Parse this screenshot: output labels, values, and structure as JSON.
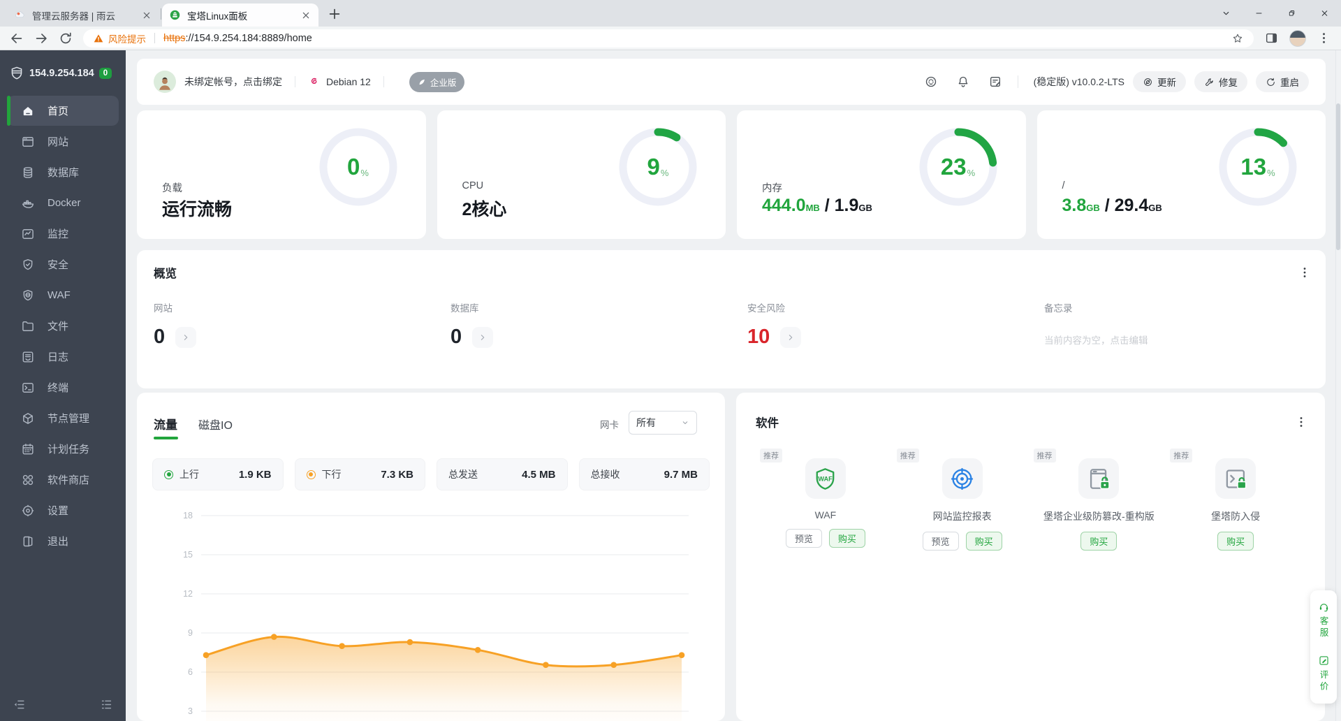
{
  "browser": {
    "tabs": [
      {
        "title": "管理云服务器 | 雨云"
      },
      {
        "title": "宝塔Linux面板"
      }
    ],
    "address": {
      "warning": "风险提示",
      "scheme": "https",
      "rest": "://154.9.254.184:8889/home"
    }
  },
  "sidebar": {
    "server_ip": "154.9.254.184",
    "badge": "0",
    "items": [
      {
        "label": "首页",
        "icon": "home",
        "active": true
      },
      {
        "label": "网站",
        "icon": "site"
      },
      {
        "label": "数据库",
        "icon": "database"
      },
      {
        "label": "Docker",
        "icon": "docker"
      },
      {
        "label": "监控",
        "icon": "monitor"
      },
      {
        "label": "安全",
        "icon": "safety"
      },
      {
        "label": "WAF",
        "icon": "waf"
      },
      {
        "label": "文件",
        "icon": "file"
      },
      {
        "label": "日志",
        "icon": "log"
      },
      {
        "label": "终端",
        "icon": "terminal"
      },
      {
        "label": "节点管理",
        "icon": "node"
      },
      {
        "label": "计划任务",
        "icon": "cron"
      },
      {
        "label": "软件商店",
        "icon": "store"
      },
      {
        "label": "设置",
        "icon": "setting"
      },
      {
        "label": "退出",
        "icon": "exit"
      }
    ]
  },
  "header": {
    "account": "未绑定帐号，点击绑定",
    "os": "Debian 12",
    "edition": "企业版",
    "version": "(稳定版) v10.0.2-LTS",
    "actions": [
      {
        "label": "更新",
        "icon": "update"
      },
      {
        "label": "修复",
        "icon": "wrench"
      },
      {
        "label": "重启",
        "icon": "restart"
      }
    ]
  },
  "stat_cards": [
    {
      "label": "负载",
      "value": "运行流畅",
      "percent": 0
    },
    {
      "label": "CPU",
      "value": "2核心",
      "percent": 9
    },
    {
      "label": "内存",
      "used": "444.0",
      "used_unit": "MB",
      "total": "1.9",
      "total_unit": "GB",
      "percent": 23
    },
    {
      "label": "/",
      "used": "3.8",
      "used_unit": "GB",
      "total": "29.4",
      "total_unit": "GB",
      "percent": 13
    }
  ],
  "overview": {
    "title": "概览",
    "items": [
      {
        "label": "网站",
        "value": "0",
        "color": "#1f242b"
      },
      {
        "label": "数据库",
        "value": "0",
        "color": "#1f242b"
      },
      {
        "label": "安全风险",
        "value": "10",
        "color": "#d9252b"
      },
      {
        "label": "备忘录",
        "placeholder": "当前内容为空，点击编辑"
      }
    ]
  },
  "traffic": {
    "tabs": [
      "流量",
      "磁盘IO"
    ],
    "active_tab": "流量",
    "nic_label": "网卡",
    "nic_value": "所有",
    "stats": [
      {
        "dot": "#21a53d",
        "label": "上行",
        "value": "1.9 KB"
      },
      {
        "dot": "#f7a125",
        "label": "下行",
        "value": "7.3 KB"
      },
      {
        "label": "总发送",
        "value": "4.5 MB"
      },
      {
        "label": "总接收",
        "value": "9.7 MB"
      }
    ],
    "chart_data": {
      "type": "area",
      "series": [
        {
          "name": "下行",
          "values": [
            7.3,
            8.7,
            8.0,
            8.3,
            7.7,
            6.55,
            6.55,
            7.3
          ]
        }
      ],
      "unit": "KB",
      "y_ticks": [
        18,
        15,
        12,
        9,
        6,
        3
      ],
      "ylim": [
        3,
        18
      ],
      "grid": true,
      "legend": false,
      "line_color": "#f7a125"
    }
  },
  "software": {
    "title": "软件",
    "items": [
      {
        "tag": "推荐",
        "icon": "wafapp",
        "name": "WAF",
        "buttons": [
          "预览",
          "购买"
        ]
      },
      {
        "tag": "推荐",
        "icon": "target",
        "name": "网站监控报表",
        "buttons": [
          "预览",
          "购买"
        ]
      },
      {
        "tag": "推荐",
        "icon": "tamper",
        "name": "堡塔企业级防篡改-重构版",
        "buttons": [
          "购买"
        ]
      },
      {
        "tag": "推荐",
        "icon": "intrusion",
        "name": "堡塔防入侵",
        "buttons": [
          "购买"
        ]
      }
    ]
  },
  "floating": {
    "items": [
      {
        "icon": "headset",
        "label": "客服"
      },
      {
        "icon": "editpen",
        "label": "评价"
      }
    ]
  },
  "colors": {
    "accent_green": "#20a53a",
    "risk_red": "#d9252b",
    "chart_orange": "#f7a125",
    "sidebar_bg": "#3d4450"
  }
}
